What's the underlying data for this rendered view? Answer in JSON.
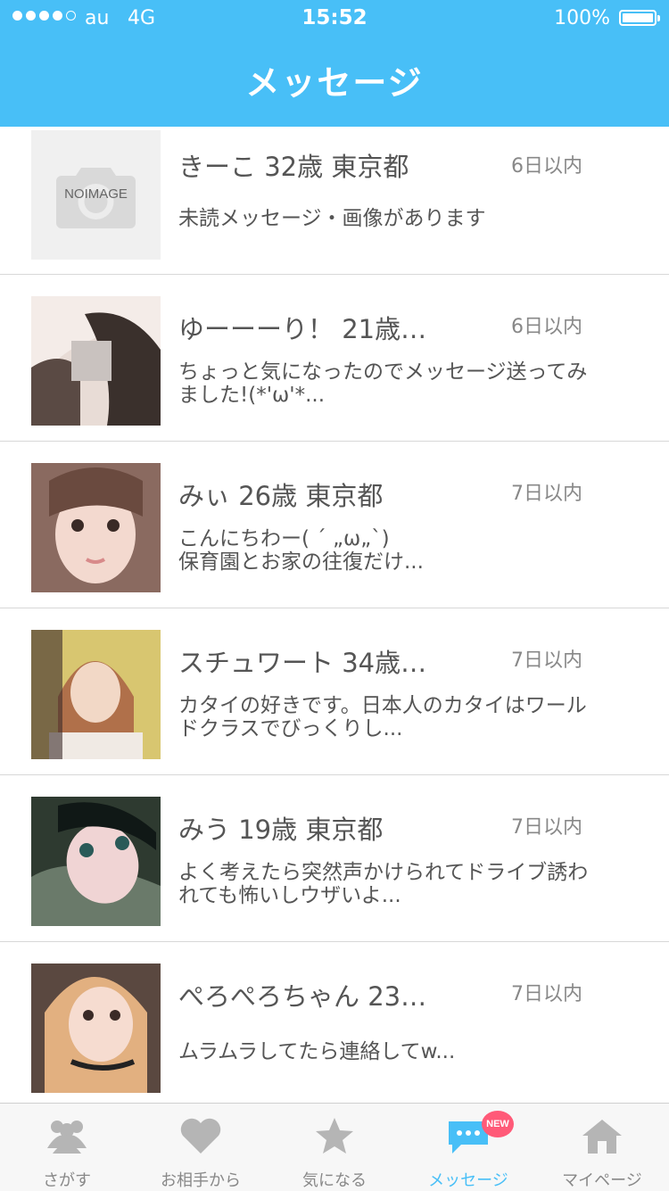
{
  "status_bar": {
    "carrier": "au",
    "network": "4G",
    "time": "15:52",
    "battery": "100%",
    "signal_bars_filled": 4,
    "signal_bars_total": 5
  },
  "header": {
    "title": "メッセージ"
  },
  "messages": [
    {
      "name": "きーこ 32歳 東京都",
      "when": "6日以内",
      "preview": "未読メッセージ・画像があります",
      "avatar_text": "NOIMAGE"
    },
    {
      "name": "ゆーーーり！ 21歳…",
      "when": "6日以内",
      "preview": "ちょっと気になったのでメッセージ送ってみました!(*'ω'*..."
    },
    {
      "name": "みぃ 26歳 東京都",
      "when": "7日以内",
      "preview": "こんにちわー( ´ „ω„`)\n保育園とお家の往復だけ..."
    },
    {
      "name": "スチュワート 34歳…",
      "when": "7日以内",
      "preview": "カタイの好きです。日本人のカタイはワールドクラスでびっくりし..."
    },
    {
      "name": "みう 19歳 東京都",
      "when": "7日以内",
      "preview": "よく考えたら突然声かけられてドライブ誘われても怖いしウザいよ..."
    },
    {
      "name": "ぺろぺろちゃん 23…",
      "when": "7日以内",
      "preview": "ムラムラしてたら連絡してw..."
    }
  ],
  "tabs": [
    {
      "label": "さがす",
      "icon": "people-icon"
    },
    {
      "label": "お相手から",
      "icon": "heart-icon"
    },
    {
      "label": "気になる",
      "icon": "star-icon"
    },
    {
      "label": "メッセージ",
      "icon": "chat-icon",
      "active": true
    },
    {
      "label": "マイページ",
      "icon": "home-icon"
    }
  ],
  "badge": "NEW",
  "colors": {
    "accent": "#48bff7",
    "badge": "#ff5a78",
    "icon_gray": "#b5b5b5"
  }
}
